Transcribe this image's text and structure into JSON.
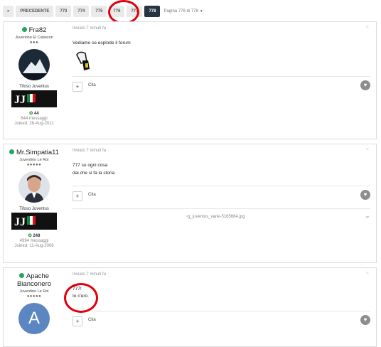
{
  "pagination": {
    "prev_label": "PRECEDENTE",
    "pages": [
      "773",
      "774",
      "775",
      "776",
      "777"
    ],
    "current": "778",
    "page_info": "Pagina 778 di 778",
    "dropdown_icon": "caret-down-icon"
  },
  "posts": [
    {
      "author": "Fra82",
      "online": true,
      "title": "Juventino El Cabezon",
      "pips": "●●●",
      "rank": "Tifoso Juventus",
      "reputation": "44",
      "messages": "644 messaggi",
      "joined": "Joined: 26-Aug-2011",
      "date": "Inviato 7 minuti fa",
      "content": [
        "Vediamo se esplode il forum"
      ],
      "quote_label": "Cita"
    },
    {
      "author": "Mr.Simpatia11",
      "online": true,
      "title": "Juventino Le Roi",
      "pips": "●●●●●",
      "rank": "Tifoso Juventus",
      "reputation": "248",
      "messages": "4994 messaggi",
      "joined": "Joined: 11-Aug-2008",
      "date": "Inviato 7 minuti fa",
      "content": [
        "777 su ogni cosa",
        "dai che si fa la storia"
      ],
      "quote_label": "Cita",
      "signature_image": "g_juventus_varie-5165684.jpg"
    },
    {
      "author_line1": "Apache",
      "author_line2": "Bianconero",
      "online": true,
      "title": "Juventino Le Roi",
      "pips": "●●●●●",
      "avatar_letter": "A",
      "date": "Inviato 7 minuti fa",
      "content": [
        "777!",
        "Io c'ero."
      ],
      "quote_label": "Cita"
    }
  ],
  "badge": {
    "line1": "TIFOSO",
    "line2": "JUVENTUS",
    "line3": "TIFOSERIA FCONCERTO"
  },
  "colors": {
    "online": "#23a55a",
    "current_page": "#263340",
    "annotation": "#e1000b",
    "avatar_a": "#5b86c2"
  }
}
